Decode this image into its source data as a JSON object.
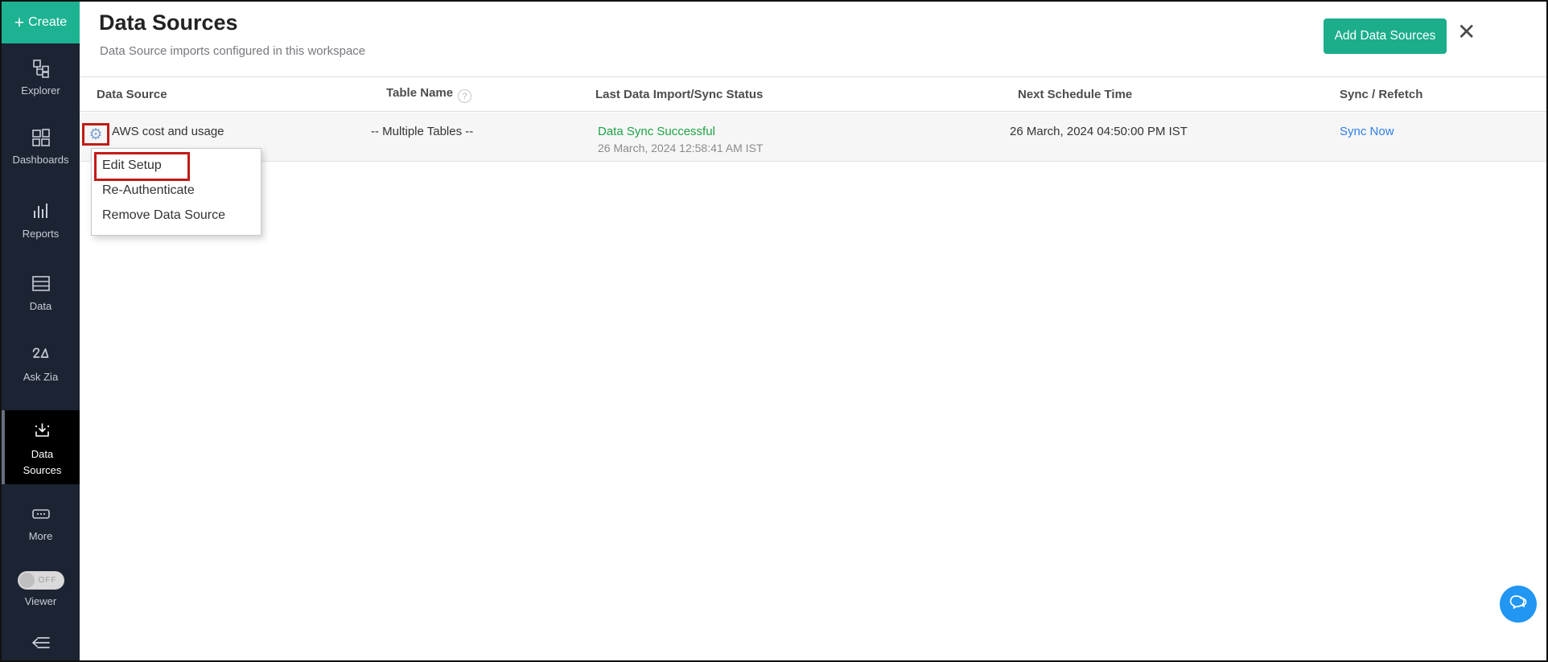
{
  "window": {
    "close_glyph": "✕"
  },
  "sidebar": {
    "create_plus": "+",
    "create_label": "Create",
    "items": [
      {
        "label": "Explorer"
      },
      {
        "label": "Dashboards"
      },
      {
        "label": "Reports"
      },
      {
        "label": "Data"
      },
      {
        "label": "Ask Zia"
      },
      {
        "label": "Data Sources",
        "active": true
      },
      {
        "label": "More"
      }
    ],
    "viewer_toggle_state": "OFF",
    "viewer_label": "Viewer"
  },
  "header": {
    "title": "Data Sources",
    "subtitle": "Data Source imports configured in this workspace",
    "add_button_label": "Add Data Sources"
  },
  "table": {
    "columns": [
      "Data Source",
      "Table Name",
      "Last Data Import/Sync Status",
      "Next Schedule Time",
      "Sync / Refetch"
    ],
    "rows": [
      {
        "data_source": "AWS cost and usage",
        "table_name": "-- Multiple Tables --",
        "last_status": "Data Sync Successful",
        "last_status_time": "26 March, 2024 12:58:41 AM IST",
        "next_schedule_time": "26 March, 2024 04:50:00 PM IST",
        "sync_action": "Sync Now"
      }
    ]
  },
  "context_menu": {
    "items": [
      "Edit Setup",
      "Re-Authenticate",
      "Remove Data Source"
    ]
  },
  "icons": {
    "help_glyph": "?",
    "settings_gear_glyph": "⚙"
  },
  "colors": {
    "sidebar_bg": "#1C2433",
    "active_item_bg": "#000000",
    "accent_teal": "#1DB392",
    "button_teal": "#1CAD8B",
    "status_success_green": "#1EA345",
    "link_blue": "#2F7FE5",
    "annotation_red": "#C11B17",
    "fab_blue": "#2196F3"
  }
}
